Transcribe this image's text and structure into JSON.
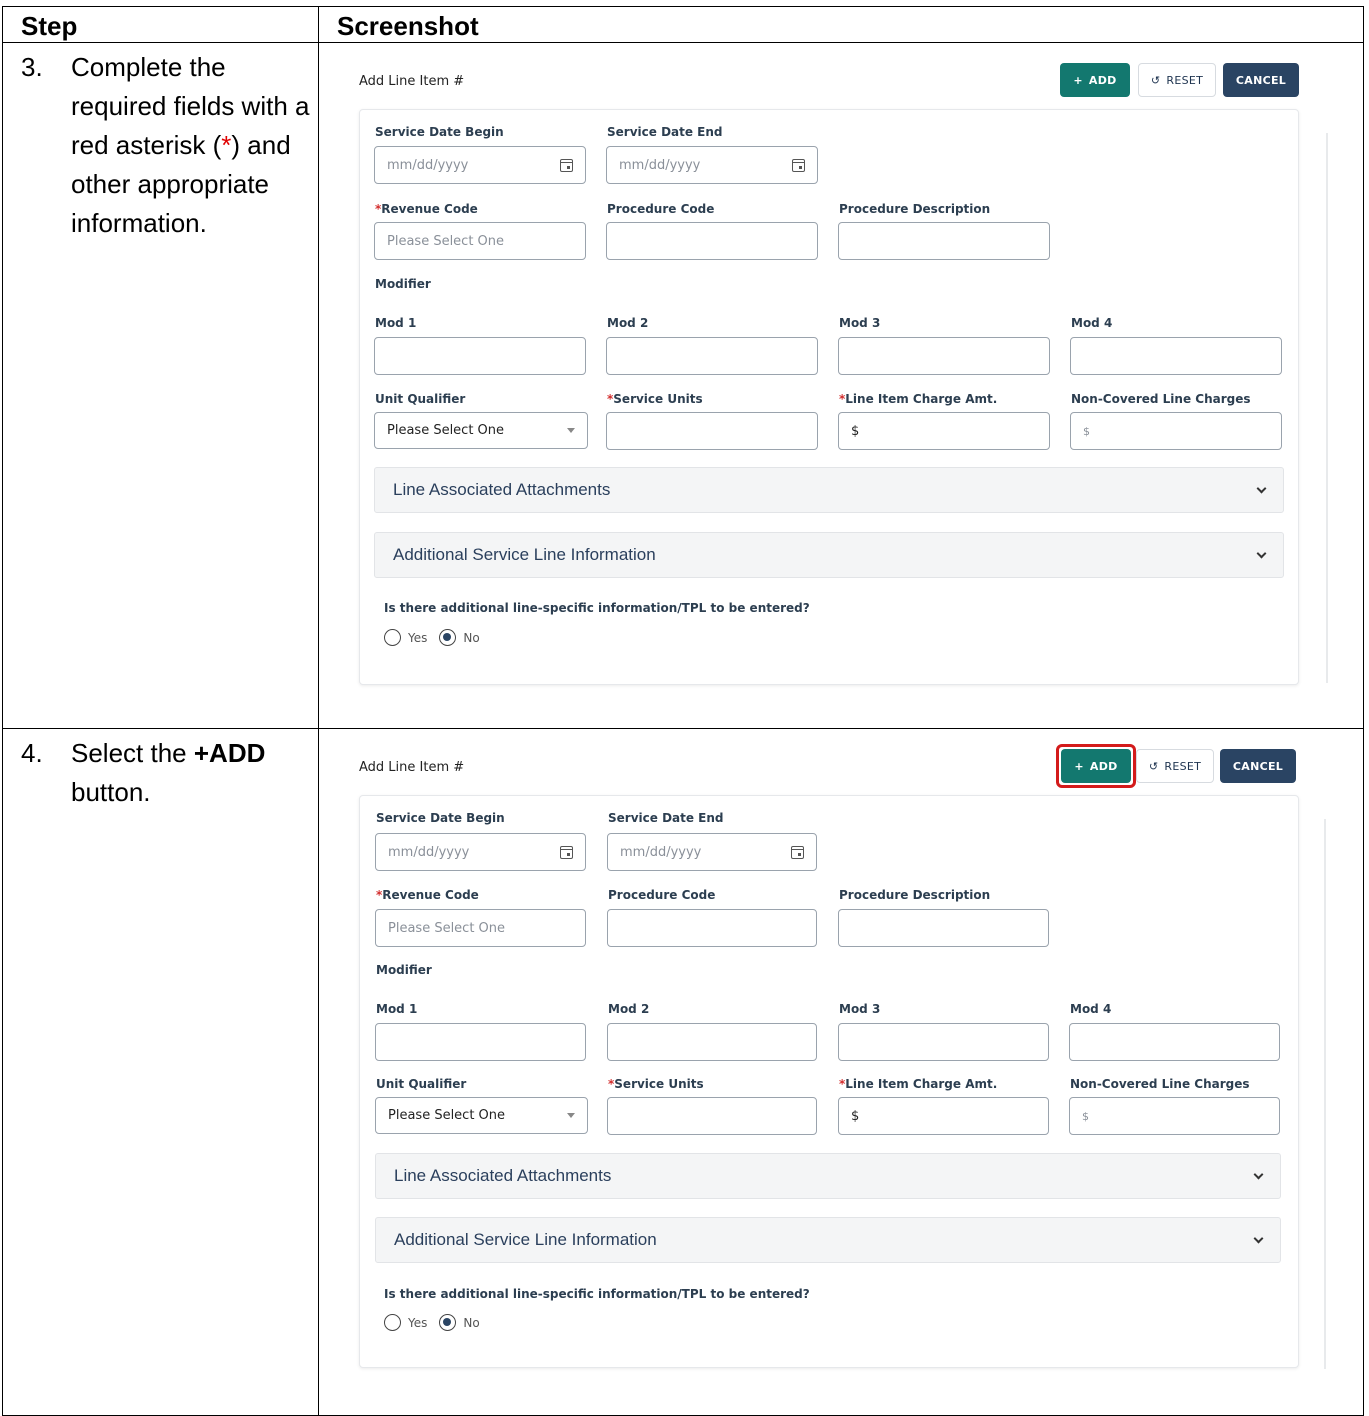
{
  "table": {
    "header_step": "Step",
    "header_screenshot": "Screenshot"
  },
  "steps": [
    {
      "number": "3.",
      "text_before": "Complete the required fields with a red asterisk (",
      "asterisk": "*",
      "text_after": ") and other appropriate information."
    },
    {
      "number": "4.",
      "text_before": "Select the ",
      "bold": "+ADD",
      "text_after": " button."
    }
  ],
  "form": {
    "title": "Add Line Item #",
    "buttons": {
      "add": "ADD",
      "add_icon": "+",
      "reset": "RESET",
      "reset_icon": "↺",
      "cancel": "CANCEL"
    },
    "labels": {
      "service_date_begin": "Service Date Begin",
      "service_date_end": "Service Date End",
      "revenue_code": "Revenue Code",
      "procedure_code": "Procedure Code",
      "procedure_description": "Procedure Description",
      "modifier": "Modifier",
      "mod1": "Mod 1",
      "mod2": "Mod 2",
      "mod3": "Mod 3",
      "mod4": "Mod 4",
      "unit_qualifier": "Unit Qualifier",
      "service_units": "Service Units",
      "line_item_charge_amt": "Line Item Charge Amt.",
      "non_covered_line_charges": "Non-Covered Line Charges",
      "required_mark": "*"
    },
    "placeholders": {
      "date": "mm/dd/yyyy",
      "revenue_code": "Please Select One",
      "unit_qualifier": "Please Select One",
      "charge_amt": "$",
      "non_covered": "$"
    },
    "accordions": {
      "attachments": "Line Associated Attachments",
      "additional_info": "Additional Service Line Information"
    },
    "question": "Is there additional line-specific information/TPL to be entered?",
    "radio": {
      "yes": "Yes",
      "no": "No",
      "selected": "No"
    },
    "highlight_color": "#d31b1b"
  }
}
